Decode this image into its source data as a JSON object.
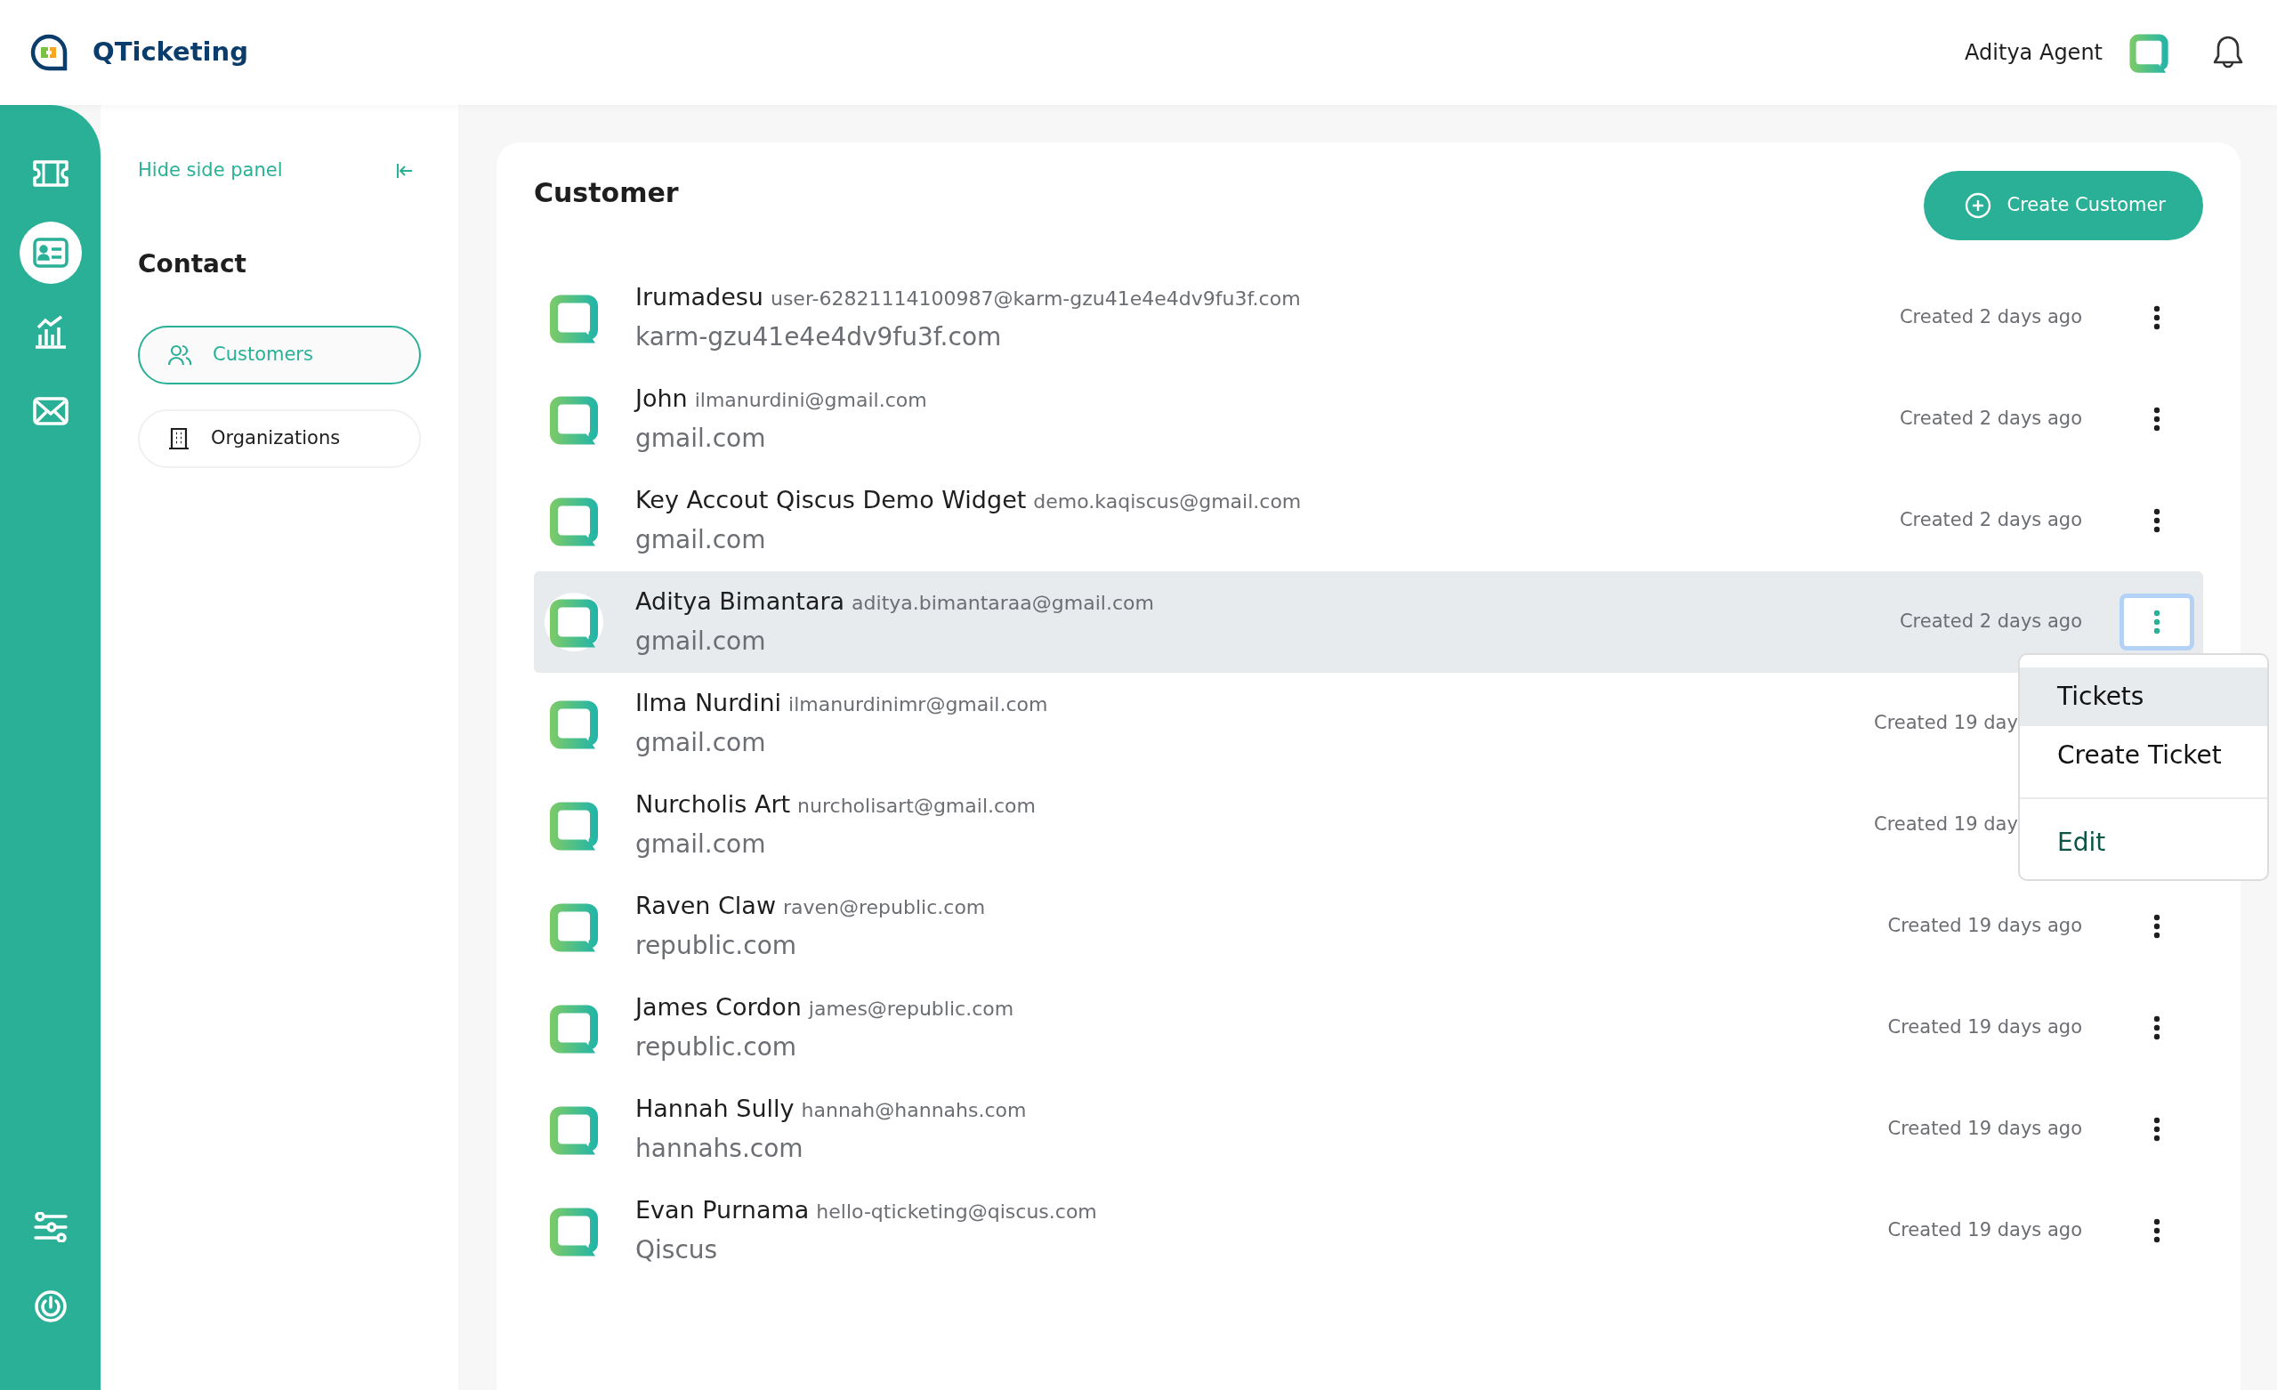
{
  "header": {
    "app_name": "QTicketing",
    "user_name": "Aditya Agent"
  },
  "rail": {
    "items": [
      {
        "selected": false
      },
      {
        "selected": true
      },
      {
        "selected": false
      },
      {
        "selected": false
      }
    ],
    "bottom_items": [
      {
        "selected": false
      },
      {
        "selected": false
      }
    ]
  },
  "side_panel": {
    "hide_label": "Hide side panel",
    "title": "Contact",
    "items": [
      {
        "label": "Customers",
        "selected": true
      },
      {
        "label": "Organizations",
        "selected": false
      }
    ]
  },
  "main": {
    "title": "Customer",
    "create_button": "Create Customer",
    "rows": [
      {
        "name": "Irumadesu",
        "email": "user-62821114100987@karm-gzu41e4e4dv9fu3f.com",
        "domain": "karm-gzu41e4e4dv9fu3f.com",
        "created": "Created 2 days ago",
        "selected": false,
        "menu_button": true
      },
      {
        "name": "John",
        "email": "ilmanurdini@gmail.com",
        "domain": "gmail.com",
        "created": "Created 2 days ago",
        "selected": false,
        "menu_button": true
      },
      {
        "name": "Key Accout Qiscus Demo Widget",
        "email": "demo.kaqiscus@gmail.com",
        "domain": "gmail.com",
        "created": "Created 2 days ago",
        "selected": false,
        "menu_button": true
      },
      {
        "name": "Aditya Bimantara",
        "email": "aditya.bimantaraa@gmail.com",
        "domain": "gmail.com",
        "created": "Created 2 days ago",
        "selected": true,
        "menu_button": true
      },
      {
        "name": "Ilma Nurdini",
        "email": "ilmanurdinimr@gmail.com",
        "domain": "gmail.com",
        "created": "Created 19 day",
        "selected": false,
        "menu_button": false
      },
      {
        "name": "Nurcholis Art",
        "email": "nurcholisart@gmail.com",
        "domain": "gmail.com",
        "created": "Created 19 day",
        "selected": false,
        "menu_button": false
      },
      {
        "name": "Raven Claw",
        "email": "raven@republic.com",
        "domain": "republic.com",
        "created": "Created 19 days ago",
        "selected": false,
        "menu_button": true
      },
      {
        "name": "James Cordon",
        "email": "james@republic.com",
        "domain": "republic.com",
        "created": "Created 19 days ago",
        "selected": false,
        "menu_button": true
      },
      {
        "name": "Hannah Sully",
        "email": "hannah@hannahs.com",
        "domain": "hannahs.com",
        "created": "Created 19 days ago",
        "selected": false,
        "menu_button": true
      },
      {
        "name": "Evan Purnama",
        "email": "hello-qticketing@qiscus.com",
        "domain": "Qiscus",
        "created": "Created 19 days ago",
        "selected": false,
        "menu_button": true
      }
    ],
    "row_menu": {
      "items": [
        {
          "label": "Tickets",
          "selected": true,
          "divider_before": false
        },
        {
          "label": "Create Ticket",
          "selected": false,
          "divider_before": false
        },
        {
          "label": "Edit",
          "selected": false,
          "divider_before": true
        }
      ]
    }
  }
}
